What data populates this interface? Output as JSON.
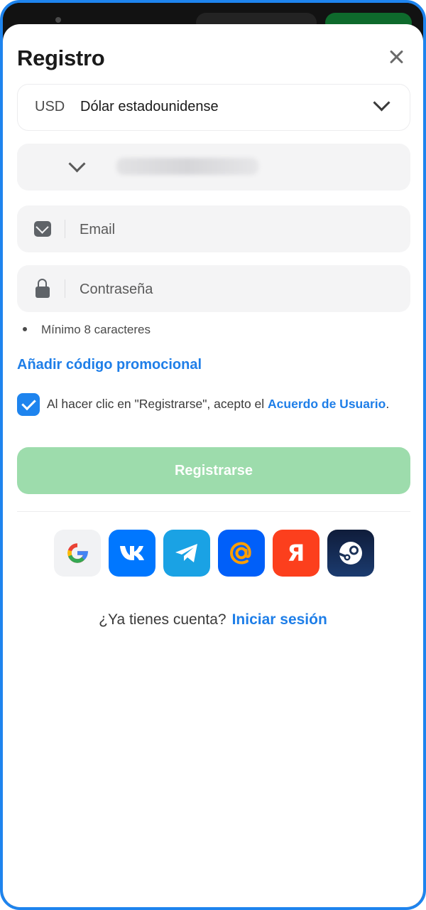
{
  "header": {
    "title": "Registro"
  },
  "currency": {
    "code": "USD",
    "name": "Dólar estadounidense"
  },
  "email": {
    "placeholder": "Email"
  },
  "password": {
    "placeholder": "Contraseña"
  },
  "hint": {
    "text": "Mínimo 8 caracteres"
  },
  "promo": {
    "label": "Añadir código promocional"
  },
  "agreement": {
    "checked": true,
    "text": "Al hacer clic en \"Registrarse\", acepto el ",
    "link": "Acuerdo de Usuario",
    "suffix": "."
  },
  "register": {
    "label": "Registrarse"
  },
  "social": {
    "items": [
      "google-icon",
      "vk-icon",
      "telegram-icon",
      "mail-ru-icon",
      "yandex-icon",
      "steam-icon"
    ],
    "yandex_glyph": "Я"
  },
  "signin": {
    "question": "¿Ya tienes cuenta?",
    "link": "Iniciar sesión"
  },
  "colors": {
    "accent": "#1e84ee",
    "button_disabled": "#9ddcac"
  }
}
